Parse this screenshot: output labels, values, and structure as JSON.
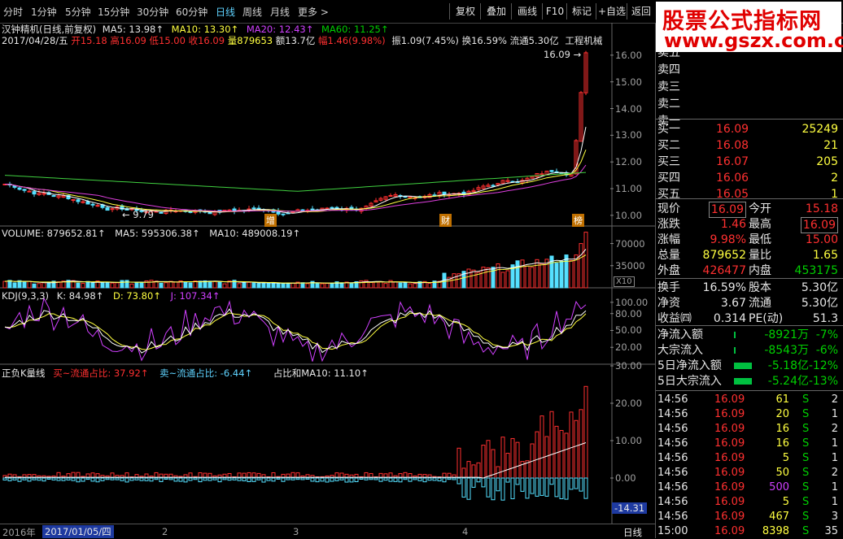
{
  "toolbar": {
    "periods": [
      "分时",
      "1分钟",
      "5分钟",
      "15分钟",
      "30分钟",
      "60分钟",
      "日线",
      "周线",
      "月线",
      "更多 >"
    ],
    "active_period": "日线",
    "buttons": [
      "复权",
      "叠加",
      "画线",
      "F10",
      "标记",
      "+自选",
      "返回"
    ]
  },
  "logo": {
    "line1": "股票公式指标网",
    "line2": "www.gszx.com.cn"
  },
  "header": {
    "stock_title": "汉钟精机(日线,前复权)",
    "ma5": "MA5: 13.98↑",
    "ma10": "MA10: 13.30↑",
    "ma20": "MA20: 12.43↑",
    "ma60": "MA60: 11.25↑",
    "date": "2017/04/28/五",
    "open": "开15.18",
    "high": "高16.09",
    "low": "低15.00",
    "close": "收16.09",
    "volume": "量879653",
    "amount": "额13.7亿",
    "change": "幅1.46(9.98%)",
    "amplitude": "振1.09(7.45%)",
    "turnover": "换16.59%",
    "float": "流通5.30亿",
    "industry": "工程机械"
  },
  "price_pane": {
    "y_ticks": [
      "16.00",
      "15.00",
      "14.00",
      "13.00",
      "12.00",
      "11.00",
      "10.00"
    ],
    "high_marker": "16.09",
    "low_marker": "9.79",
    "event_tags": [
      "增",
      "财",
      "榜"
    ]
  },
  "volume_pane": {
    "title": "VOLUME: 879652.81↑",
    "ma5": "MA5: 595306.38↑",
    "ma10": "MA10: 489008.19↑",
    "y_ticks": [
      "70000",
      "35000"
    ],
    "unit": "X10"
  },
  "kdj_pane": {
    "title": "KDJ(9,3,3)",
    "k": "K: 84.98↑",
    "d": "D: 73.80↑",
    "j": "J: 107.34↑",
    "y_ticks": [
      "100.00",
      "80.00",
      "50.00",
      "20.00"
    ]
  },
  "zf_pane": {
    "title": "正负K量线",
    "buy": "买~流通占比: 37.92↑",
    "sell": "卖~流通占比: -6.44↑",
    "ma": "占比和MA10: 11.10↑",
    "y_ticks": [
      "30.00",
      "20.00",
      "10.00",
      "0.00"
    ],
    "cursor_value": "-14.31"
  },
  "bottom_bar": {
    "year": "2016年",
    "cursor_date": "2017/01/05/四",
    "months": [
      "2",
      "3",
      "4"
    ],
    "period": "日线"
  },
  "order_book": {
    "asks": [
      {
        "label": "卖五",
        "price": "",
        "vol": ""
      },
      {
        "label": "卖四",
        "price": "",
        "vol": ""
      },
      {
        "label": "卖三",
        "price": "",
        "vol": ""
      },
      {
        "label": "卖二",
        "price": "",
        "vol": ""
      },
      {
        "label": "卖一",
        "price": "",
        "vol": ""
      }
    ],
    "bids": [
      {
        "label": "买一",
        "price": "16.09",
        "vol": "25249"
      },
      {
        "label": "买二",
        "price": "16.08",
        "vol": "21"
      },
      {
        "label": "买三",
        "price": "16.07",
        "vol": "205"
      },
      {
        "label": "买四",
        "price": "16.06",
        "vol": "2"
      },
      {
        "label": "买五",
        "price": "16.05",
        "vol": "1"
      }
    ]
  },
  "quote": [
    {
      "l1": "现价",
      "v1": "16.09",
      "l2": "今开",
      "v2": "15.18"
    },
    {
      "l1": "涨跌",
      "v1": "1.46",
      "l2": "最高",
      "v2": "16.09"
    },
    {
      "l1": "涨幅",
      "v1": "9.98%",
      "l2": "最低",
      "v2": "15.00"
    },
    {
      "l1": "总量",
      "v1": "879652",
      "l2": "量比",
      "v2": "1.65"
    },
    {
      "l1": "外盘",
      "v1": "426477",
      "l2": "内盘",
      "v2": "453175"
    }
  ],
  "fundamentals": [
    {
      "l1": "换手",
      "v1": "16.59%",
      "l2": "股本",
      "v2": "5.30亿"
    },
    {
      "l1": "净资",
      "v1": "3.67",
      "l2": "流通",
      "v2": "5.30亿"
    },
    {
      "l1": "收益㈣",
      "v1": "0.314",
      "l2": "PE(动)",
      "v2": "51.3"
    }
  ],
  "flows": [
    {
      "label": "净流入额",
      "value": "-8921万",
      "pct": "-7%",
      "bar": 0.04
    },
    {
      "label": "大宗流入",
      "value": "-8543万",
      "pct": "-6%",
      "bar": 0.04
    },
    {
      "label": "5日净流入额",
      "value": "-5.18亿",
      "pct": "-12%",
      "bar": 0.9
    },
    {
      "label": "5日大宗流入",
      "value": "-5.24亿",
      "pct": "-13%",
      "bar": 0.9
    }
  ],
  "ticks": [
    {
      "time": "14:56",
      "price": "16.09",
      "vol": "61",
      "side": "S",
      "n": "2"
    },
    {
      "time": "14:56",
      "price": "16.09",
      "vol": "20",
      "side": "S",
      "n": "1"
    },
    {
      "time": "14:56",
      "price": "16.09",
      "vol": "16",
      "side": "S",
      "n": "2"
    },
    {
      "time": "14:56",
      "price": "16.09",
      "vol": "16",
      "side": "S",
      "n": "1"
    },
    {
      "time": "14:56",
      "price": "16.09",
      "vol": "5",
      "side": "S",
      "n": "1"
    },
    {
      "time": "14:56",
      "price": "16.09",
      "vol": "50",
      "side": "S",
      "n": "2"
    },
    {
      "time": "14:56",
      "price": "16.09",
      "vol": "500",
      "side": "S",
      "n": "1"
    },
    {
      "time": "14:56",
      "price": "16.09",
      "vol": "5",
      "side": "S",
      "n": "1"
    },
    {
      "time": "14:56",
      "price": "16.09",
      "vol": "467",
      "side": "S",
      "n": "3"
    },
    {
      "time": "15:00",
      "price": "16.09",
      "vol": "8398",
      "side": "S",
      "n": "35"
    }
  ],
  "colors": {
    "up": "#ff3030",
    "down": "#55e0ff",
    "ma5": "#ffffff",
    "ma10": "#ffff40",
    "ma20": "#e040e0",
    "ma60": "#40d040"
  }
}
